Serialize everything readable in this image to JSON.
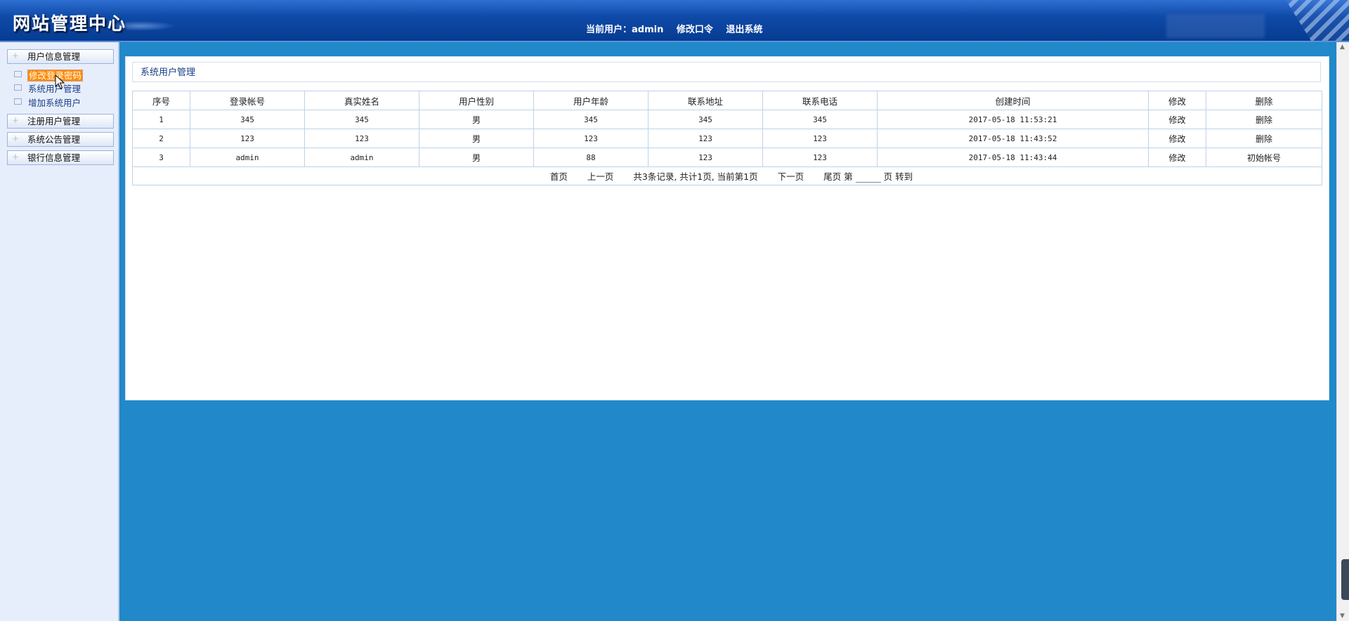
{
  "header": {
    "logo": "网站管理中心",
    "current_user": "当前用户：admin",
    "change_password": "修改口令",
    "logout": "退出系统"
  },
  "sidebar": {
    "groups": [
      {
        "label": "用户信息管理"
      },
      {
        "label": "注册用户管理"
      },
      {
        "label": "系统公告管理"
      },
      {
        "label": "银行信息管理"
      }
    ],
    "sub_items": [
      {
        "label": "修改登录密码"
      },
      {
        "label": "系统用户管理"
      },
      {
        "label": "增加系统用户"
      }
    ]
  },
  "main": {
    "section_title": "系统用户管理",
    "table": {
      "headers": [
        "序号",
        "登录帐号",
        "真实姓名",
        "用户性别",
        "用户年龄",
        "联系地址",
        "联系电话",
        "创建时间",
        "修改",
        "删除"
      ],
      "rows": [
        {
          "no": "1",
          "account": "345",
          "name": "345",
          "gender": "男",
          "age": "345",
          "address": "345",
          "phone": "345",
          "created": "2017-05-18 11:53:21",
          "edit": "修改",
          "action": "删除"
        },
        {
          "no": "2",
          "account": "123",
          "name": "123",
          "gender": "男",
          "age": "123",
          "address": "123",
          "phone": "123",
          "created": "2017-05-18 11:43:52",
          "edit": "修改",
          "action": "删除"
        },
        {
          "no": "3",
          "account": "admin",
          "name": "admin",
          "gender": "男",
          "age": "88",
          "address": "123",
          "phone": "123",
          "created": "2017-05-18 11:43:44",
          "edit": "修改",
          "action": "初始帐号"
        }
      ]
    },
    "pager": {
      "first": "首页",
      "prev": "上一页",
      "summary": "共3条记录, 共计1页, 当前第1页",
      "next": "下一页",
      "last": "尾页",
      "page_prefix": "第",
      "page_suffix": "页",
      "goto": "转到"
    }
  },
  "colors": {
    "header_bg": "#0f4aa8",
    "main_bg": "#2188c9",
    "sidebar_bg": "#e7eefb",
    "active_item": "#ff8a00"
  }
}
